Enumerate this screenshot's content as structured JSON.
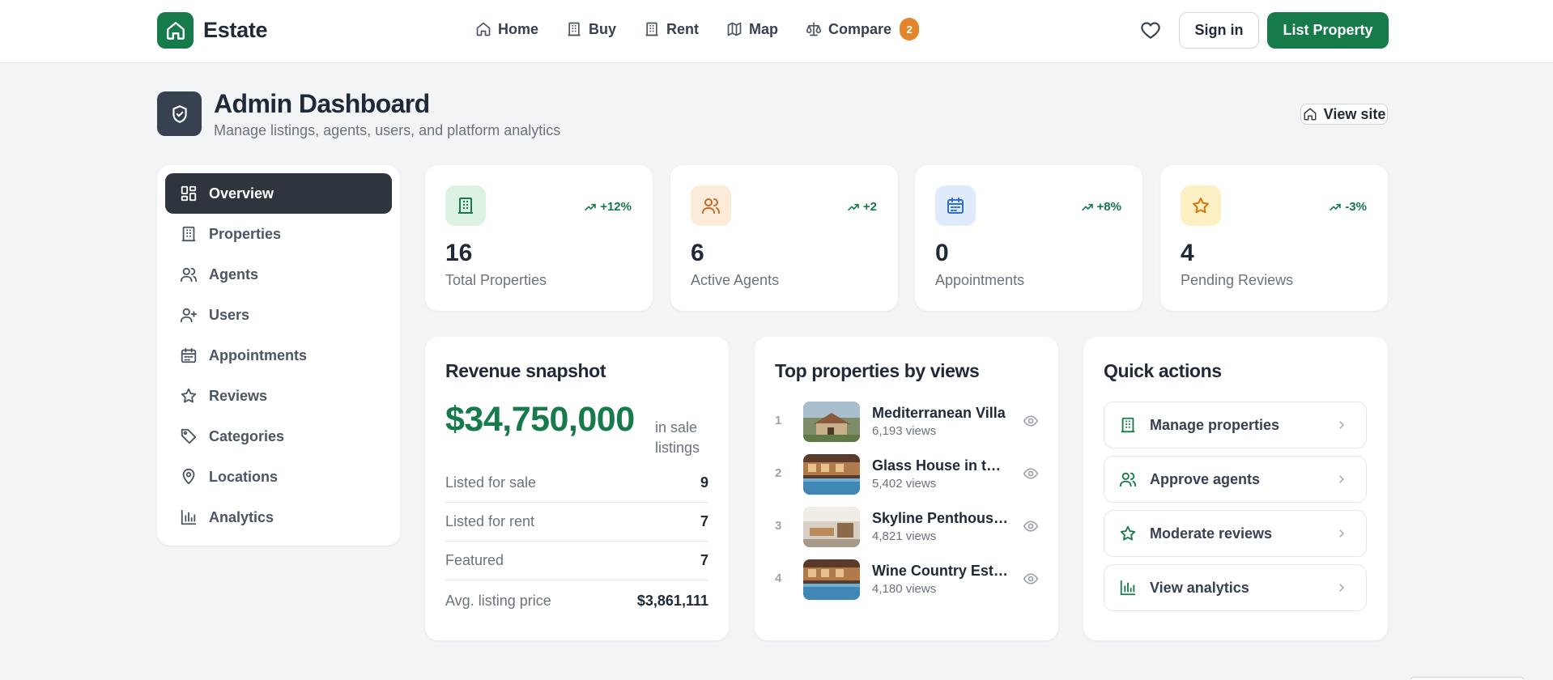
{
  "header": {
    "brand_name": "Estate",
    "nav": [
      {
        "label": "Home",
        "icon": "home-icon"
      },
      {
        "label": "Buy",
        "icon": "building-icon"
      },
      {
        "label": "Rent",
        "icon": "building-icon"
      },
      {
        "label": "Map",
        "icon": "map-icon"
      },
      {
        "label": "Compare",
        "icon": "scale-icon",
        "badge": "2"
      }
    ],
    "sign_in_label": "Sign in",
    "list_property_label": "List Property"
  },
  "page": {
    "title": "Admin Dashboard",
    "subtitle": "Manage listings, agents, users, and platform analytics",
    "view_site_label": "View site"
  },
  "sidebar": {
    "items": [
      {
        "label": "Overview",
        "icon": "grid-icon",
        "active": true
      },
      {
        "label": "Properties",
        "icon": "building-icon"
      },
      {
        "label": "Agents",
        "icon": "users-icon"
      },
      {
        "label": "Users",
        "icon": "user-plus-icon"
      },
      {
        "label": "Appointments",
        "icon": "calendar-icon"
      },
      {
        "label": "Reviews",
        "icon": "star-icon"
      },
      {
        "label": "Categories",
        "icon": "tag-icon"
      },
      {
        "label": "Locations",
        "icon": "map-pin-icon"
      },
      {
        "label": "Analytics",
        "icon": "bar-chart-icon"
      }
    ]
  },
  "stats": [
    {
      "value": "16",
      "label": "Total Properties",
      "delta": "+12%",
      "icon": "building-icon",
      "icon_color": "#167a4a",
      "icon_bg": "#dcf2e3"
    },
    {
      "value": "6",
      "label": "Active Agents",
      "delta": "+2",
      "icon": "users-icon",
      "icon_color": "#c2692a",
      "icon_bg": "#fbebd8"
    },
    {
      "value": "0",
      "label": "Appointments",
      "delta": "+8%",
      "icon": "calendar-icon",
      "icon_color": "#2f6fd1",
      "icon_bg": "#dfeafc"
    },
    {
      "value": "4",
      "label": "Pending Reviews",
      "delta": "-3%",
      "icon": "star-icon",
      "icon_color": "#d9730d",
      "icon_bg": "#fdf0c4"
    }
  ],
  "revenue": {
    "title": "Revenue snapshot",
    "amount": "$34,750,000",
    "unit": "in sale listings",
    "rows": [
      {
        "label": "Listed for sale",
        "value": "9"
      },
      {
        "label": "Listed for rent",
        "value": "7"
      },
      {
        "label": "Featured",
        "value": "7"
      },
      {
        "label": "Avg. listing price",
        "value": "$3,861,111"
      }
    ]
  },
  "top_properties": {
    "title": "Top properties by views",
    "items": [
      {
        "rank": "1",
        "name": "Mediterranean Villa",
        "views": "6,193 views"
      },
      {
        "rank": "2",
        "name": "Glass House in the Hills",
        "views": "5,402 views"
      },
      {
        "rank": "3",
        "name": "Skyline Penthouse Suite",
        "views": "4,821 views"
      },
      {
        "rank": "4",
        "name": "Wine Country Estate",
        "views": "4,180 views"
      }
    ]
  },
  "quick_actions": {
    "title": "Quick actions",
    "items": [
      {
        "label": "Manage properties",
        "icon": "building-icon"
      },
      {
        "label": "Approve agents",
        "icon": "users-icon"
      },
      {
        "label": "Moderate reviews",
        "icon": "star-icon"
      },
      {
        "label": "View analytics",
        "icon": "bar-chart-icon"
      }
    ]
  },
  "colors": {
    "brand_green": "#167a4a",
    "dark": "#2e353f",
    "badge_orange": "#e3852b",
    "background": "#f3f4f6"
  }
}
